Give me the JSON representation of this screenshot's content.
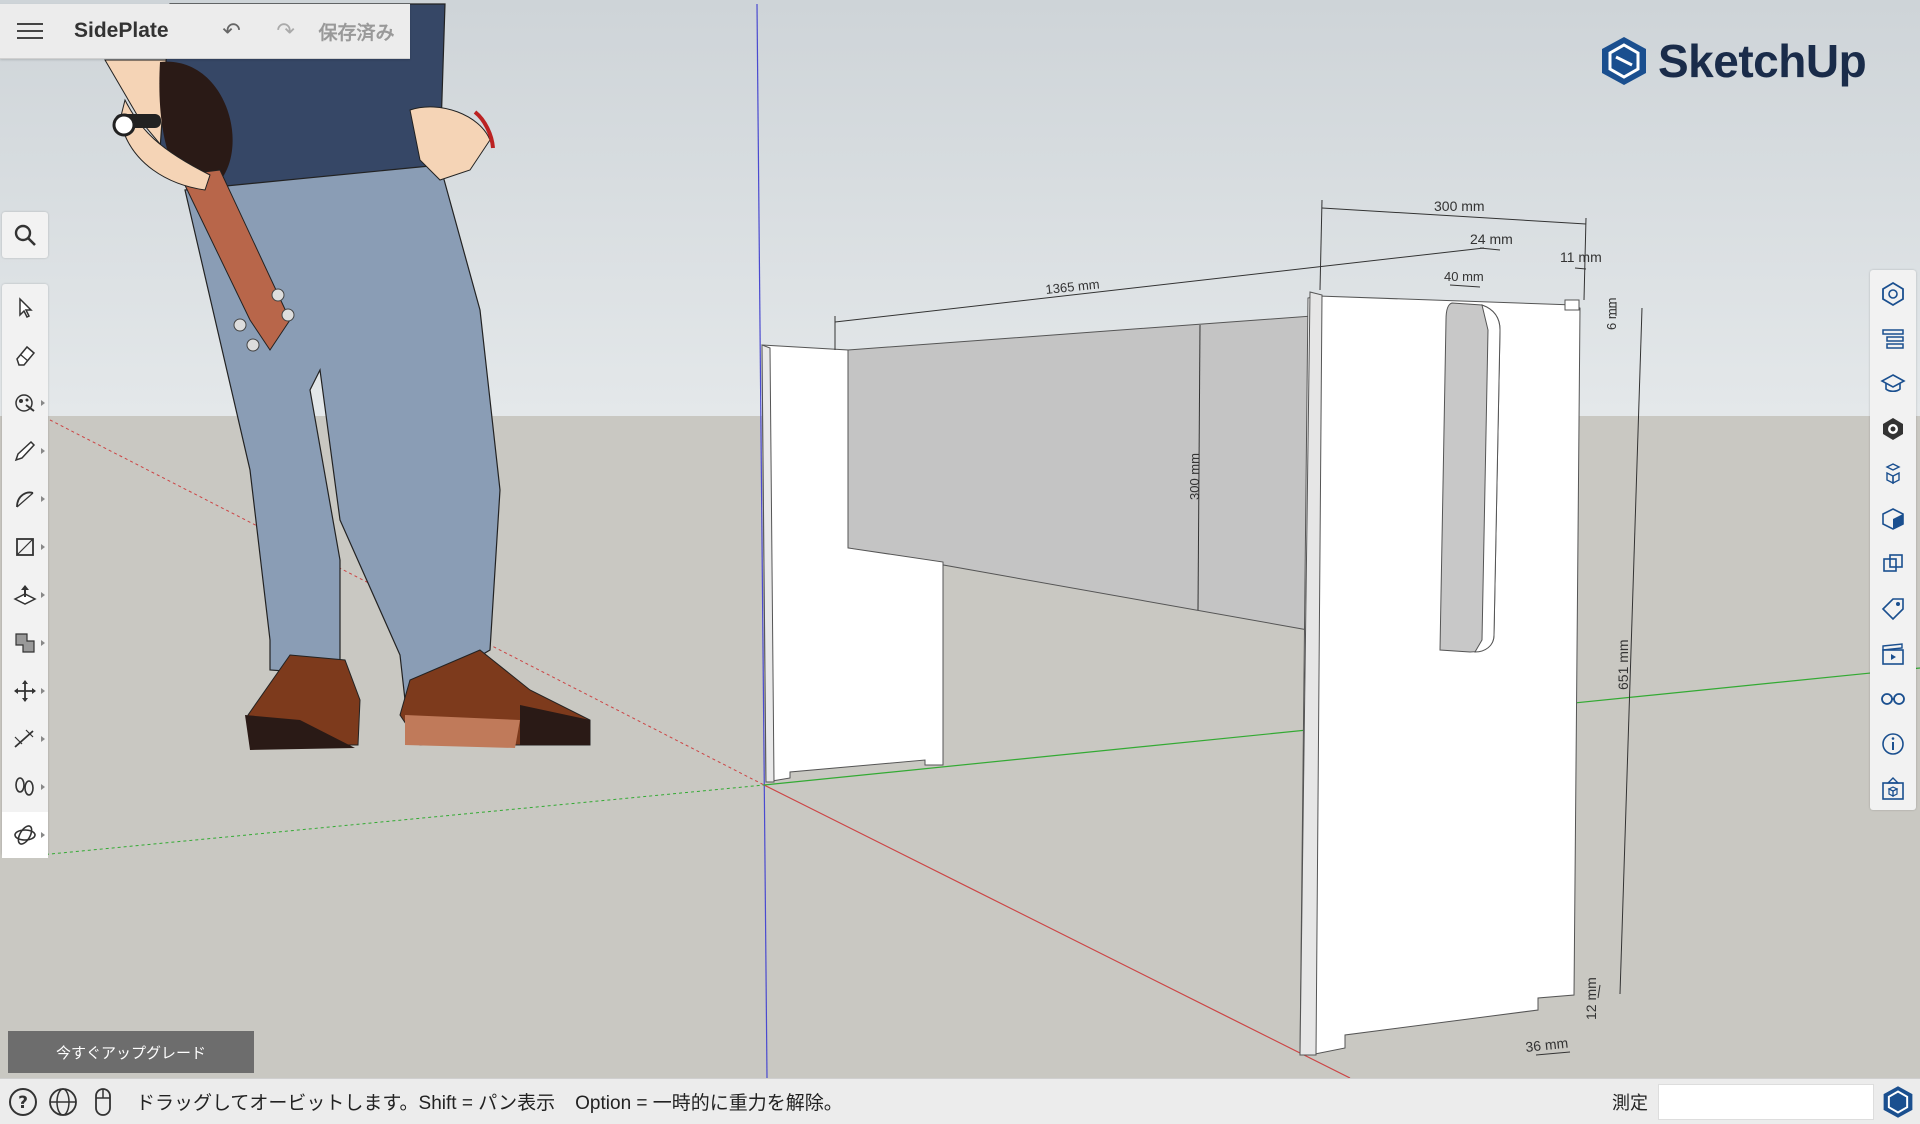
{
  "header": {
    "title": "SidePlate",
    "saved_status": "保存済み"
  },
  "logo": {
    "brand": "SketchUp",
    "color": "#1a4f8f"
  },
  "left_toolbar": {
    "tools": [
      "search-icon",
      "select-icon",
      "eraser-icon",
      "paint-bucket-icon",
      "pencil-icon",
      "arc-icon",
      "rectangle-icon",
      "push-pull-icon",
      "offset-icon",
      "move-icon",
      "tape-measure-icon",
      "walk-icon",
      "orbit-icon"
    ]
  },
  "right_toolbar": {
    "panels": [
      "entity-info-icon",
      "outliner-icon",
      "instructor-icon",
      "materials-icon",
      "components-icon",
      "styles-icon",
      "solid-tools-icon",
      "tags-icon",
      "scenes-icon",
      "display-icon",
      "model-info-icon",
      "3d-warehouse-icon"
    ]
  },
  "dimensions": {
    "d1": "300 mm",
    "d2": "24 mm",
    "d3": "40 mm",
    "d4": "11 mm",
    "d5": "1365 mm",
    "d6": "6 mm",
    "d7": "300 mm",
    "d8": "651 mm",
    "d9": "12 mm",
    "d10": "36 mm"
  },
  "upgrade": {
    "label": "今すぐアップグレード"
  },
  "status": {
    "hint": "ドラッグしてオービットします。Shift = パン表示",
    "hint2": "Option = 一時的に重力を解除。",
    "measure_label": "測定",
    "measure_value": ""
  }
}
